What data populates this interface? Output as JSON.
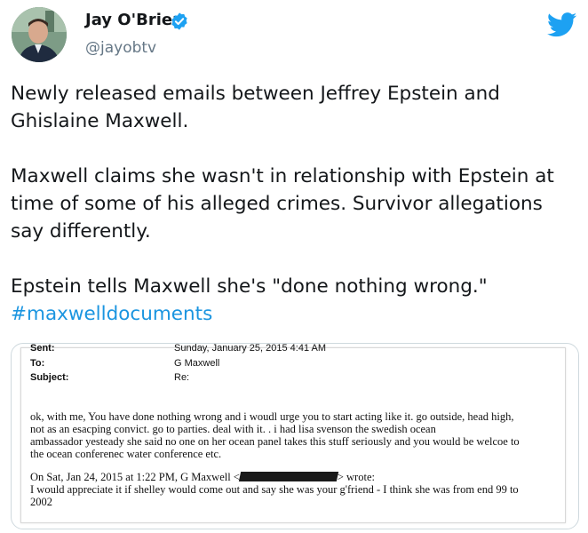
{
  "user": {
    "name": "Jay O'Brien",
    "handle": "@jayobtv"
  },
  "tweet": {
    "lines": [
      "Newly released emails between Jeffrey Epstein and",
      "Ghislaine Maxwell.",
      "",
      "Maxwell claims she wasn't in relationship with Epstein at",
      "time of some of his alleged crimes. Survivor allegations",
      "say differently.",
      "",
      "Epstein tells Maxwell she's \"done nothing wrong.\""
    ],
    "hashtag": "#maxwelldocuments"
  },
  "document": {
    "sent_label": "Sent:",
    "sent_value": "Sunday, January 25, 2015 4:41 AM",
    "to_label": "To:",
    "to_value": "G Maxwell",
    "subject_label": "Subject:",
    "subject_value": "Re:",
    "body_lines": [
      "ok, with me,   You have done nothing wrong and i woudl urge you to start acting like it.   go outside, head high,",
      "not as an esacping convict.   go to parties.  deal with it. .   i had lisa svenson the swedish ocean",
      "ambassador  yesteady she said no one on her ocean panel takes this stuff seriously and you would be welcoe to",
      "the ocean conferenec water conference etc."
    ],
    "quote_intro_a": "On Sat, Jan 24, 2015 at 1:22 PM, G Maxwell <",
    "quote_intro_b": "> wrote:",
    "quote_lines": [
      "I would appreciate it if shelley would come out and say she was your g'friend - I think she was from end 99 to",
      "2002"
    ]
  },
  "colors": {
    "link": "#1b95e0",
    "verified": "#1da1f2",
    "twitter": "#1da1f2",
    "handle": "#657786"
  },
  "icons": [
    "verified-badge-icon",
    "twitter-bird-icon"
  ]
}
